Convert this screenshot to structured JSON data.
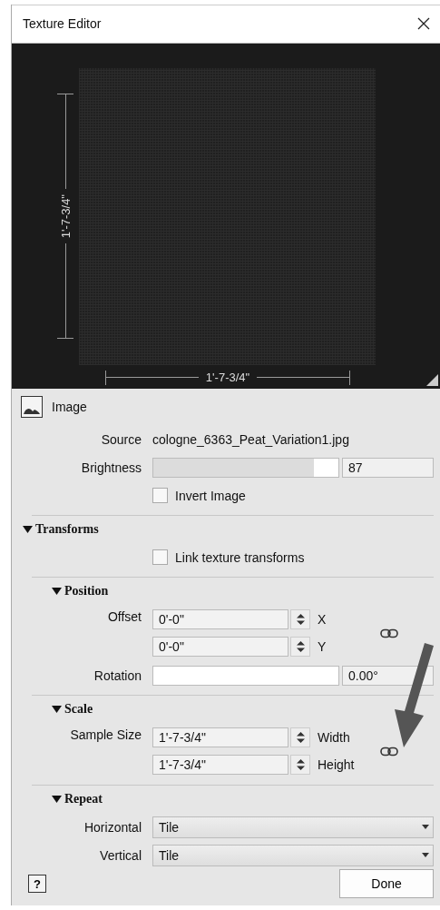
{
  "window": {
    "title": "Texture Editor"
  },
  "preview": {
    "height_label": "1'-7-3/4\"",
    "width_label": "1'-7-3/4\""
  },
  "image": {
    "heading": "Image",
    "source": {
      "label": "Source",
      "value": "cologne_6363_Peat_Variation1.jpg"
    },
    "brightness": {
      "label": "Brightness",
      "level": 0.87,
      "reading": "87"
    },
    "invert": {
      "label": "Invert Image",
      "checked": false
    }
  },
  "transforms": {
    "heading": "Transforms",
    "expanded": true,
    "link": {
      "label": "Link texture transforms",
      "checked": false
    },
    "position": {
      "heading": "Position",
      "expanded": true,
      "offset_label": "Offset",
      "offset_x": {
        "value": "0'-0\"",
        "axis": "X"
      },
      "offset_y": {
        "value": "0'-0\"",
        "axis": "Y"
      },
      "rotation": {
        "label": "Rotation",
        "level": 0,
        "reading": "0.00°"
      }
    },
    "scale": {
      "heading": "Scale",
      "expanded": true,
      "sample_size_label": "Sample Size",
      "width": {
        "value": "1'-7-3/4\"",
        "axis": "Width"
      },
      "height": {
        "value": "1'-7-3/4\"",
        "axis": "Height"
      }
    },
    "repeat": {
      "heading": "Repeat",
      "expanded": true,
      "horizontal": {
        "label": "Horizontal",
        "value": "Tile"
      },
      "vertical": {
        "label": "Vertical",
        "value": "Tile"
      }
    }
  },
  "footer": {
    "help": "?",
    "done": "Done"
  }
}
